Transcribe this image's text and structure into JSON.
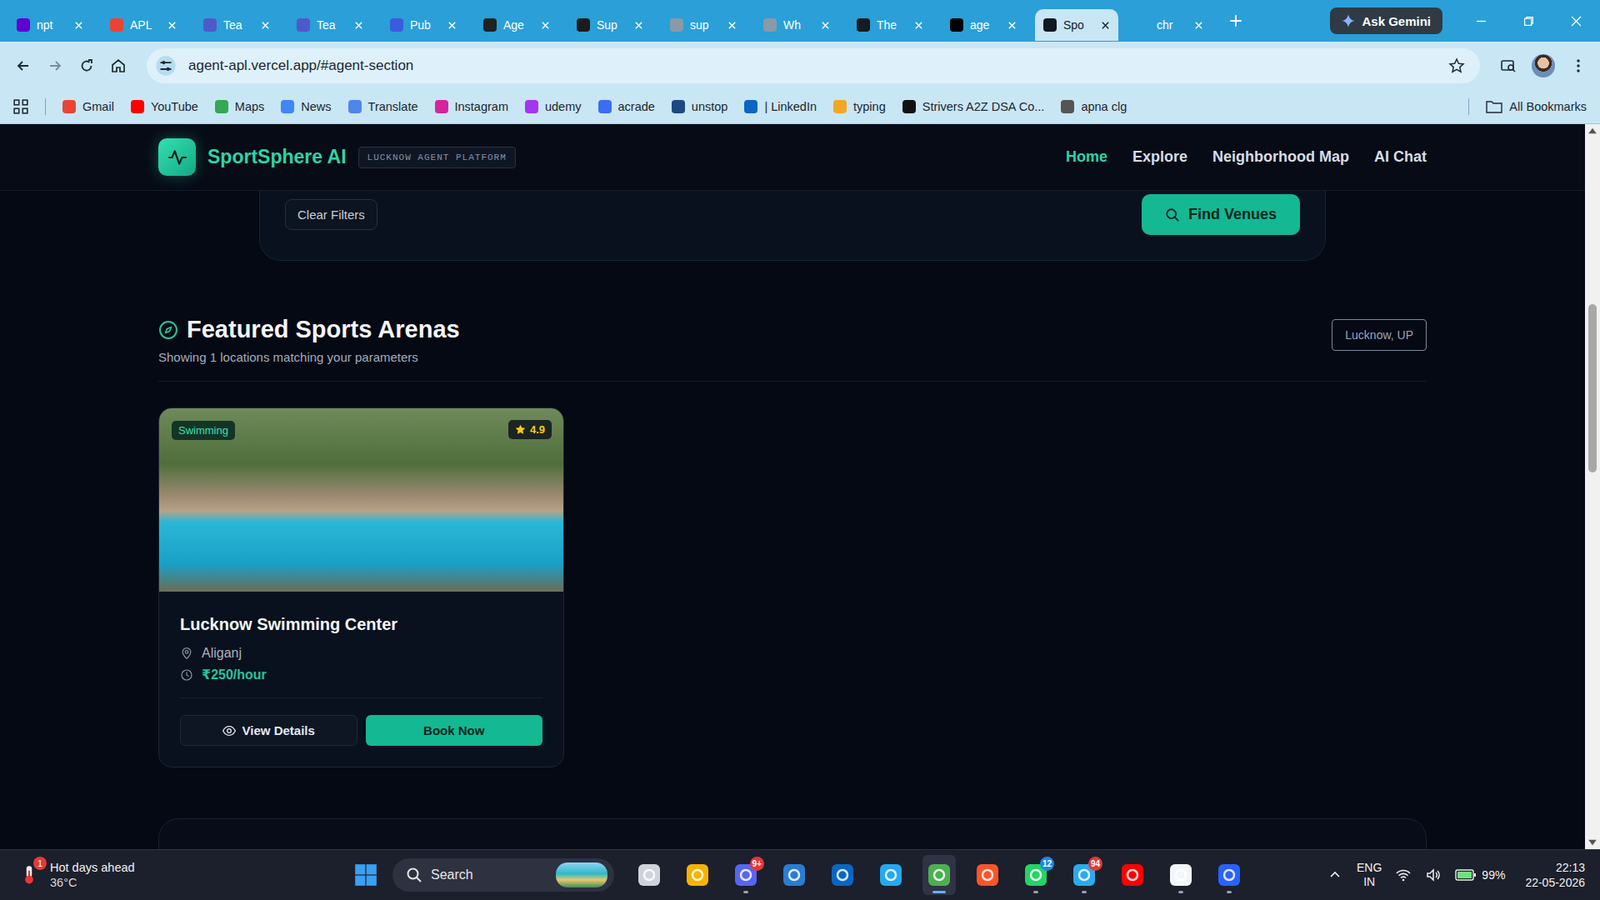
{
  "browser": {
    "tabs": [
      {
        "label": "npt",
        "selected": false,
        "color": "#6001d2"
      },
      {
        "label": "APL",
        "selected": false,
        "color": "#ea4335"
      },
      {
        "label": "Tea",
        "selected": false,
        "color": "#5059c9"
      },
      {
        "label": "Tea",
        "selected": false,
        "color": "#5059c9"
      },
      {
        "label": "Pub",
        "selected": false,
        "color": "#3b5bdb"
      },
      {
        "label": "Age",
        "selected": false,
        "color": "#202123"
      },
      {
        "label": "Sup",
        "selected": false,
        "color": "#1c1c1c"
      },
      {
        "label": "sup",
        "selected": false,
        "color": "#8a9aa8"
      },
      {
        "label": "Wh",
        "selected": false,
        "color": "#8a9aa8"
      },
      {
        "label": "The",
        "selected": false,
        "color": "#161b22"
      },
      {
        "label": "age",
        "selected": false,
        "color": "#000000"
      },
      {
        "label": "Spo",
        "selected": true,
        "color": "#0f1a24"
      },
      {
        "label": "chr",
        "selected": false,
        "color": "#2a9fd8"
      }
    ],
    "ask_button": "Ask Gemini",
    "url": "agent-apl.vercel.app/#agent-section",
    "bookmarks": [
      {
        "label": "Gmail",
        "color": "#ea4335"
      },
      {
        "label": "YouTube",
        "color": "#ff0000"
      },
      {
        "label": "Maps",
        "color": "#34a853"
      },
      {
        "label": "News",
        "color": "#4285f4"
      },
      {
        "label": "Translate",
        "color": "#4f86ec"
      },
      {
        "label": "Instagram",
        "color": "#d6249f"
      },
      {
        "label": "udemy",
        "color": "#a435f0"
      },
      {
        "label": "acrade",
        "color": "#3c6df0"
      },
      {
        "label": "unstop",
        "color": "#1c4980"
      },
      {
        "label": "| LinkedIn",
        "color": "#0a66c2"
      },
      {
        "label": "typing",
        "color": "#f5a623"
      },
      {
        "label": "Strivers A2Z DSA Co...",
        "color": "#111111"
      },
      {
        "label": "apna clg",
        "color": "#555555"
      }
    ],
    "all_bookmarks": "All Bookmarks"
  },
  "page": {
    "brand": "SportSphere AI",
    "brand_badge": "LUCKNOW AGENT PLATFORM",
    "nav": [
      {
        "label": "Home",
        "selected": true
      },
      {
        "label": "Explore",
        "selected": false
      },
      {
        "label": "Neighborhood Map",
        "selected": false
      },
      {
        "label": "AI Chat",
        "selected": false
      }
    ],
    "filters": {
      "clear": "Clear Filters",
      "submit": "Find Venues"
    },
    "section": {
      "title": "Featured Sports Arenas",
      "subtitle": "Showing 1 locations matching your parameters",
      "location": "Lucknow, UP"
    },
    "venues": [
      {
        "sport": "Swimming",
        "rating": "4.9",
        "name": "Lucknow Swimming Center",
        "area": "Aliganj",
        "price": "₹250/hour",
        "details_button": "View Details",
        "book_button": "Book Now"
      }
    ]
  },
  "taskbar": {
    "weather": {
      "title": "Hot days ahead",
      "temp": "36°C",
      "badge": "1"
    },
    "search": "Search",
    "apps": [
      {
        "name": "task-view",
        "color": "#cfd3da",
        "badge": "",
        "badge_color": "#e53935",
        "running": false,
        "selected": false
      },
      {
        "name": "file-explorer",
        "color": "#f4b400",
        "badge": "",
        "badge_color": "#e53935",
        "running": false,
        "selected": false
      },
      {
        "name": "discord",
        "color": "#5865f2",
        "badge": "9+",
        "badge_color": "#e53935",
        "running": true,
        "selected": false
      },
      {
        "name": "store",
        "color": "#2b7cd3",
        "badge": "",
        "badge_color": "#e53935",
        "running": false,
        "selected": false
      },
      {
        "name": "linkedin",
        "color": "#0a66c2",
        "badge": "",
        "badge_color": "#e53935",
        "running": false,
        "selected": false
      },
      {
        "name": "vscode",
        "color": "#23a9f2",
        "badge": "",
        "badge_color": "#e53935",
        "running": false,
        "selected": false
      },
      {
        "name": "chrome",
        "color": "#4caf50",
        "badge": "",
        "badge_color": "#e53935",
        "running": true,
        "selected": true
      },
      {
        "name": "brave",
        "color": "#fb542b",
        "badge": "",
        "badge_color": "#e53935",
        "running": false,
        "selected": false
      },
      {
        "name": "whatsapp",
        "color": "#25d366",
        "badge": "12",
        "badge_color": "#1e88e5",
        "running": true,
        "selected": false
      },
      {
        "name": "telegram",
        "color": "#2aabee",
        "badge": "94",
        "badge_color": "#e53935",
        "running": true,
        "selected": false
      },
      {
        "name": "youtube",
        "color": "#ff0000",
        "badge": "",
        "badge_color": "#e53935",
        "running": false,
        "selected": false
      },
      {
        "name": "app-a",
        "color": "#f2f5fb",
        "badge": "",
        "badge_color": "#e53935",
        "running": true,
        "selected": false
      },
      {
        "name": "app-b",
        "color": "#2962ff",
        "badge": "",
        "badge_color": "#e53935",
        "running": true,
        "selected": false
      }
    ],
    "tray": {
      "language": "ENG",
      "region": "IN",
      "battery": "99%",
      "time": "22:13",
      "date": "22-05-2026"
    }
  }
}
